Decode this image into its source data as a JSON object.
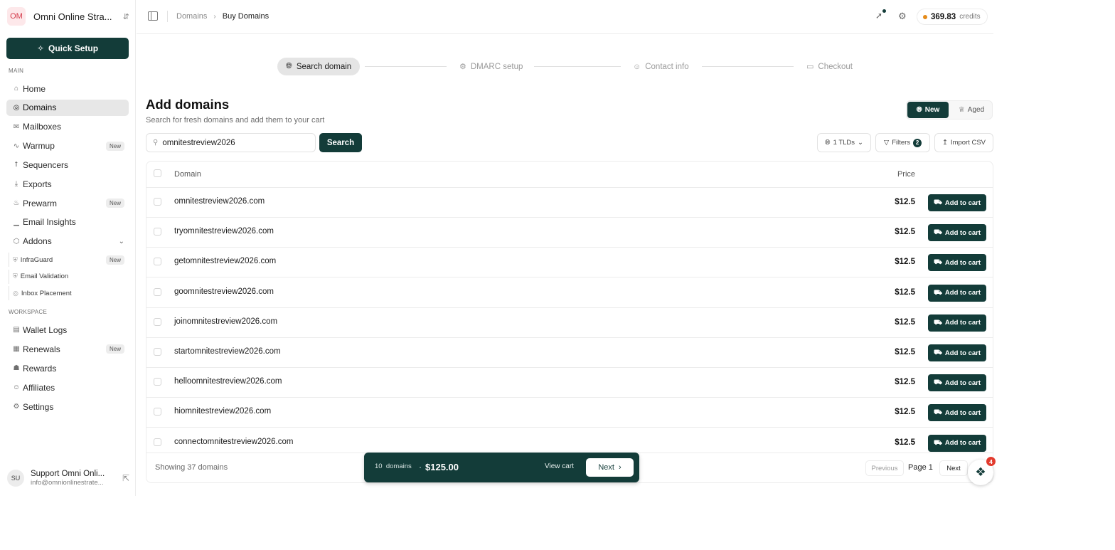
{
  "workspace": {
    "initials": "OM",
    "name": "Omni Online Stra...",
    "switch_icon": "chevrons-up-down-icon"
  },
  "sidebar": {
    "quick_setup_label": "Quick Setup",
    "section_main": "MAIN",
    "section_workspace": "WORKSPACE",
    "main_items": [
      {
        "label": "Home",
        "icon": "home-icon"
      },
      {
        "label": "Domains",
        "icon": "globe-icon",
        "active": true
      },
      {
        "label": "Mailboxes",
        "icon": "mail-icon"
      },
      {
        "label": "Warmup",
        "icon": "activity-icon",
        "badge": "New"
      },
      {
        "label": "Sequencers",
        "icon": "workflow-icon"
      },
      {
        "label": "Exports",
        "icon": "download-icon"
      },
      {
        "label": "Prewarm",
        "icon": "flame-icon",
        "badge": "New"
      },
      {
        "label": "Email Insights",
        "icon": "bar-chart-icon"
      },
      {
        "label": "Addons",
        "icon": "package-icon",
        "expandable": true
      }
    ],
    "addon_items": [
      {
        "label": "InfraGuard",
        "icon": "shield-icon",
        "badge": "New"
      },
      {
        "label": "Email Validation",
        "icon": "shield-check-icon"
      },
      {
        "label": "Inbox Placement",
        "icon": "target-icon"
      }
    ],
    "workspace_items": [
      {
        "label": "Wallet Logs",
        "icon": "wallet-icon"
      },
      {
        "label": "Renewals",
        "icon": "calendar-icon",
        "badge": "New"
      },
      {
        "label": "Rewards",
        "icon": "gift-icon"
      },
      {
        "label": "Affiliates",
        "icon": "users-icon"
      },
      {
        "label": "Settings",
        "icon": "settings-icon"
      }
    ]
  },
  "user": {
    "initials": "SU",
    "name": "Support Omni Onli...",
    "email": "info@omnionlinestrate..."
  },
  "header": {
    "breadcrumb_parent": "Domains",
    "breadcrumb_current": "Buy Domains",
    "credits_amount": "369.83",
    "credits_label": "credits"
  },
  "stepper": [
    {
      "label": "Search domain",
      "icon": "globe-icon",
      "active": true
    },
    {
      "label": "DMARC setup",
      "icon": "settings-icon"
    },
    {
      "label": "Contact info",
      "icon": "user-plus-icon"
    },
    {
      "label": "Checkout",
      "icon": "credit-card-icon"
    }
  ],
  "page": {
    "title": "Add domains",
    "subtitle": "Search for fresh domains and add them to your cart",
    "toggle_new": "New",
    "toggle_aged": "Aged"
  },
  "search": {
    "value": "omnitestreview2026",
    "button_label": "Search"
  },
  "toolbar": {
    "tlds_label": "1 TLDs",
    "filters_label": "Filters",
    "filters_count": "2",
    "import_label": "Import CSV"
  },
  "table": {
    "col_domain": "Domain",
    "col_price": "Price",
    "add_label": "Add to cart",
    "rows": [
      {
        "domain": "omnitestreview2026.com",
        "price": "$12.5"
      },
      {
        "domain": "tryomnitestreview2026.com",
        "price": "$12.5"
      },
      {
        "domain": "getomnitestreview2026.com",
        "price": "$12.5"
      },
      {
        "domain": "goomnitestreview2026.com",
        "price": "$12.5"
      },
      {
        "domain": "joinomnitestreview2026.com",
        "price": "$12.5"
      },
      {
        "domain": "startomnitestreview2026.com",
        "price": "$12.5"
      },
      {
        "domain": "helloomnitestreview2026.com",
        "price": "$12.5"
      },
      {
        "domain": "hiomnitestreview2026.com",
        "price": "$12.5"
      },
      {
        "domain": "connectomnitestreview2026.com",
        "price": "$12.5"
      }
    ],
    "showing": "Showing 37 domains",
    "prev_label": "Previous",
    "page_label": "Page 1",
    "next_label": "Next"
  },
  "cart": {
    "count_number": "10",
    "count_word": "domains",
    "total": "$125.00",
    "view_label": "View cart",
    "next_label": "Next"
  },
  "widget": {
    "badge": "4"
  },
  "colors": {
    "primary": "#133c39",
    "badge_red": "#e23b2e",
    "credits_dot": "#e58b1a"
  }
}
